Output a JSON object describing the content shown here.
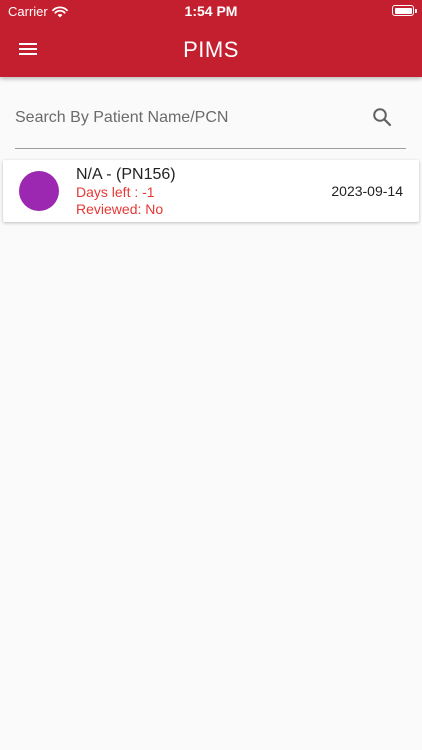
{
  "status_bar": {
    "carrier": "Carrier",
    "time": "1:54 PM"
  },
  "header": {
    "title": "PIMS",
    "background_color": "#c41f2f",
    "menu_icon": "hamburger-menu-icon"
  },
  "search": {
    "placeholder": "Search By Patient Name/PCN",
    "value": "",
    "icon": "search-icon"
  },
  "patients": [
    {
      "title": "N/A - (PN156)",
      "days_left": "Days left : -1",
      "reviewed": "Reviewed: No",
      "date": "2023-09-14",
      "avatar_color": "#9c27b0"
    }
  ]
}
